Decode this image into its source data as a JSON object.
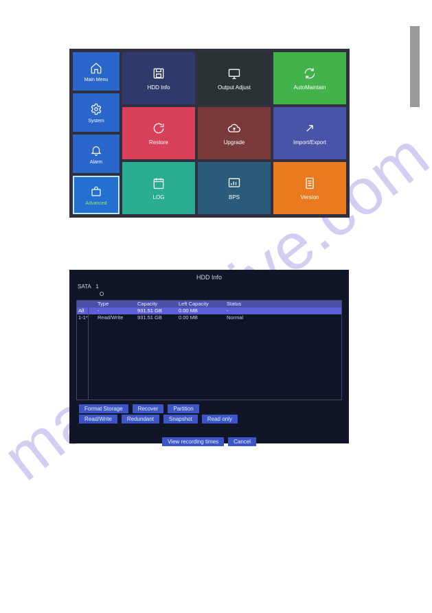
{
  "watermark_text": "manualshive.com",
  "sidebar": {
    "items": [
      {
        "label": "Main Menu",
        "active": false
      },
      {
        "label": "System",
        "active": false
      },
      {
        "label": "Alarm",
        "active": false
      },
      {
        "label": "Advanced",
        "active": true
      }
    ]
  },
  "tiles": [
    {
      "label": "HDD Info",
      "color": "#2f3a6a",
      "icon": "floppy-icon"
    },
    {
      "label": "Output Adjust",
      "color": "#2b3236",
      "icon": "monitor-icon"
    },
    {
      "label": "AutoMaintain",
      "color": "#43b24a",
      "icon": "refresh-icon"
    },
    {
      "label": "Restore",
      "color": "#d94059",
      "icon": "reload-icon"
    },
    {
      "label": "Upgrade",
      "color": "#7a3a3a",
      "icon": "cloud-up-icon"
    },
    {
      "label": "Import/Export",
      "color": "#4754a8",
      "icon": "expand-icon"
    },
    {
      "label": "LOG",
      "color": "#2aae8f",
      "icon": "calendar-icon"
    },
    {
      "label": "BPS",
      "color": "#2a5b7a",
      "icon": "chart-icon"
    },
    {
      "label": "Version",
      "color": "#e97a1f",
      "icon": "document-icon"
    }
  ],
  "hdd": {
    "title": "HDD Info",
    "sata_label": "SATA",
    "sata_value": "1",
    "sata_status": "O",
    "columns": [
      "",
      "Type",
      "Capacity",
      "Left Capacity",
      "Status",
      ""
    ],
    "rows": [
      {
        "idx": "All",
        "type": "-",
        "capacity": "931.51 GB",
        "left": "0.00 MB",
        "status": "-",
        "selected": true
      },
      {
        "idx": "1-1*",
        "type": "Read/Write",
        "capacity": "931.51 GB",
        "left": "0.00 MB",
        "status": "Normal",
        "selected": false
      }
    ],
    "action_buttons_1": [
      "Format Storage",
      "Recover",
      "Partition"
    ],
    "action_buttons_2": [
      "Read/Write",
      "Redundant",
      "Snapshot",
      "Read only"
    ],
    "bottom_buttons": [
      "View recording times",
      "Cancel"
    ]
  }
}
